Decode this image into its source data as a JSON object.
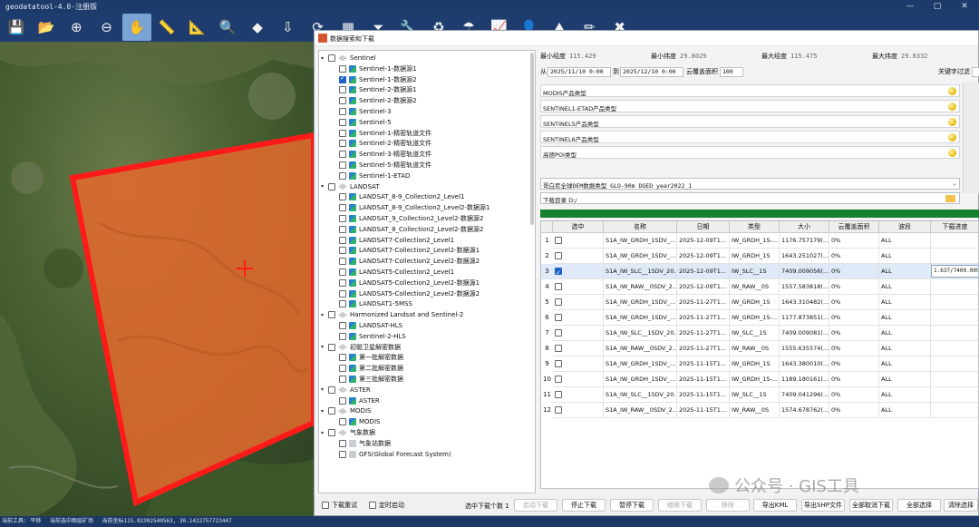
{
  "app": {
    "title": "geodatatool-4.0-注册版"
  },
  "toolbar": {
    "tools": [
      {
        "name": "save-icon",
        "glyph": "💾",
        "active": false
      },
      {
        "name": "open-folder-icon",
        "glyph": "📂",
        "active": false
      },
      {
        "name": "zoom-in-icon",
        "glyph": "⊕",
        "active": false
      },
      {
        "name": "zoom-out-icon",
        "glyph": "⊖",
        "active": false
      },
      {
        "name": "pan-hand-icon",
        "glyph": "✋",
        "active": true
      },
      {
        "name": "measure-ruler-icon",
        "glyph": "📏",
        "active": false
      },
      {
        "name": "measure-area-icon",
        "glyph": "📐",
        "active": false
      },
      {
        "name": "search-icon",
        "glyph": "🔍",
        "active": false
      },
      {
        "name": "layers-icon",
        "glyph": "◆",
        "active": false
      },
      {
        "name": "download-icon",
        "glyph": "⇩",
        "active": false
      },
      {
        "name": "refresh-icon",
        "glyph": "⟳",
        "active": false
      },
      {
        "name": "grid-icon",
        "glyph": "▦",
        "active": false
      },
      {
        "name": "filter-icon",
        "glyph": "⏷",
        "active": false
      },
      {
        "name": "settings-wrench-icon",
        "glyph": "🔧",
        "active": false
      },
      {
        "name": "sync-icon",
        "glyph": "♻",
        "active": false
      },
      {
        "name": "weather-icon",
        "glyph": "☂",
        "active": false
      },
      {
        "name": "chart-icon",
        "glyph": "📈",
        "active": false
      },
      {
        "name": "user-icon",
        "glyph": "👤",
        "active": false
      },
      {
        "name": "dem-icon",
        "glyph": "⛰",
        "active": false
      },
      {
        "name": "edit-pencil-icon",
        "glyph": "✏",
        "active": false
      },
      {
        "name": "close-red-icon",
        "glyph": "✖",
        "active": false
      }
    ]
  },
  "window_controls": {
    "minimize": "—",
    "restore": "▢",
    "close": "✕"
  },
  "status_bar": {
    "tool_text": "当前工具: 平移",
    "mode_text": "当前选中图层矿场",
    "coords_text": "当前坐标115.02302540563, 30.1422757723447"
  },
  "dialog": {
    "title": "数据搜索和下载",
    "tree": [
      {
        "level": 0,
        "caret": "▾",
        "label": "Sentinel",
        "checked": false,
        "icon": "group"
      },
      {
        "level": 1,
        "label": "Sentinel-1-数据源1",
        "checked": false,
        "icon": "item"
      },
      {
        "level": 1,
        "label": "Sentinel-1-数据源2",
        "checked": true,
        "icon": "item"
      },
      {
        "level": 1,
        "label": "Sentinel-2-数据源1",
        "checked": false,
        "icon": "item"
      },
      {
        "level": 1,
        "label": "Sentinel-2-数据源2",
        "checked": false,
        "icon": "item"
      },
      {
        "level": 1,
        "label": "Sentinel-3",
        "checked": false,
        "icon": "item"
      },
      {
        "level": 1,
        "label": "Sentinel-5",
        "checked": false,
        "icon": "item"
      },
      {
        "level": 1,
        "label": "Sentinel-1-精密轨道文件",
        "checked": false,
        "icon": "item"
      },
      {
        "level": 1,
        "label": "Sentinel-2-精密轨道文件",
        "checked": false,
        "icon": "item"
      },
      {
        "level": 1,
        "label": "Sentinel-3-精密轨道文件",
        "checked": false,
        "icon": "item"
      },
      {
        "level": 1,
        "label": "Sentinel-5-精密轨道文件",
        "checked": false,
        "icon": "item"
      },
      {
        "level": 1,
        "label": "Sentinel-1-ETAD",
        "checked": false,
        "icon": "item"
      },
      {
        "level": 0,
        "caret": "▾",
        "label": "LANDSAT",
        "checked": false,
        "icon": "group"
      },
      {
        "level": 1,
        "label": "LANDSAT_8-9_Collection2_Level1",
        "checked": false,
        "icon": "item"
      },
      {
        "level": 1,
        "label": "LANDSAT_8-9_Collection2_Level2-数据源1",
        "checked": false,
        "icon": "item"
      },
      {
        "level": 1,
        "label": "LANDSAT_9_Collection2_Level2-数据源2",
        "checked": false,
        "icon": "item"
      },
      {
        "level": 1,
        "label": "LANDSAT_8_Collection2_Level2-数据源2",
        "checked": false,
        "icon": "item"
      },
      {
        "level": 1,
        "label": "LANDSAT7-Collection2_Level1",
        "checked": false,
        "icon": "item"
      },
      {
        "level": 1,
        "label": "LANDSAT7-Collection2_Level2-数据源1",
        "checked": false,
        "icon": "item"
      },
      {
        "level": 1,
        "label": "LANDSAT7-Collection2_Level2-数据源2",
        "checked": false,
        "icon": "item"
      },
      {
        "level": 1,
        "label": "LANDSAT5-Collection2_Level1",
        "checked": false,
        "icon": "item"
      },
      {
        "level": 1,
        "label": "LANDSAT5-Collection2_Level2-数据源1",
        "checked": false,
        "icon": "item"
      },
      {
        "level": 1,
        "label": "LANDSAT5-Collection2_Level2-数据源2",
        "checked": false,
        "icon": "item"
      },
      {
        "level": 1,
        "label": "LANDSAT1-5MSS",
        "checked": false,
        "icon": "item"
      },
      {
        "level": 0,
        "caret": "▾",
        "label": "Harmonized Landsat and Sentinel-2",
        "checked": false,
        "icon": "group"
      },
      {
        "level": 1,
        "label": "LANDSAT-HLS",
        "checked": false,
        "icon": "item"
      },
      {
        "level": 1,
        "label": "Sentinel-2-HLS",
        "checked": false,
        "icon": "item"
      },
      {
        "level": 0,
        "caret": "▾",
        "label": "初聪卫星解密数据",
        "checked": false,
        "icon": "group"
      },
      {
        "level": 1,
        "label": "第一批解密数据",
        "checked": false,
        "icon": "item"
      },
      {
        "level": 1,
        "label": "第二批解密数据",
        "checked": false,
        "icon": "item"
      },
      {
        "level": 1,
        "label": "第三批解密数据",
        "checked": false,
        "icon": "item"
      },
      {
        "level": 0,
        "caret": "▾",
        "label": "ASTER",
        "checked": false,
        "icon": "group"
      },
      {
        "level": 1,
        "label": "ASTER",
        "checked": false,
        "icon": "item"
      },
      {
        "level": 0,
        "caret": "▾",
        "label": "MODIS",
        "checked": false,
        "icon": "group"
      },
      {
        "level": 1,
        "label": "MODIS",
        "checked": false,
        "icon": "item"
      },
      {
        "level": 0,
        "caret": "▾",
        "label": "气象数据",
        "checked": false,
        "icon": "group"
      },
      {
        "level": 1,
        "label": "气象站数据",
        "checked": false,
        "icon": "gray"
      },
      {
        "level": 1,
        "label": "GFS(Global Forecast System)",
        "checked": false,
        "icon": "gray"
      }
    ],
    "bounds": {
      "min_lon_label": "最小经度",
      "min_lon": "115.429",
      "min_lat_label": "最小纬度",
      "min_lat": "29.8029",
      "max_lon_label": "最大经度",
      "max_lon": "115.475",
      "max_lat_label": "最大纬度",
      "max_lat": "29.8332"
    },
    "filters": {
      "from_label": "从",
      "from_date": "2025/11/10 0:00",
      "to_label": "到",
      "to_date": "2025/12/10 0:00",
      "cloud_label": "云覆盖面积",
      "cloud_value": "100",
      "keyword_label": "关键字过滤"
    },
    "product_types": [
      "MODIS产品类型",
      "SENTINEL1-ETAD产品类型",
      "SENTINEL5产品类型",
      "SENTINEL6产品类型",
      "高德POI类型"
    ],
    "dem_select": "哥白尼全球DEM数据类型 GLO-90m DGED year2022_1",
    "download_dir": "下载目录 D:/",
    "table": {
      "columns": [
        "选中",
        "名称",
        "日期",
        "类型",
        "大小",
        "云覆盖面积",
        "波段",
        "下载进度"
      ],
      "rows": [
        {
          "num": "1",
          "checked": false,
          "name": "S1A_IW_GRDH_1SDV_...",
          "date": "2025-12-09T1...",
          "type": "IW_GRDH_1S-...",
          "size": "1176.757179(...",
          "cloud": "0%",
          "band": "ALL",
          "progress": ""
        },
        {
          "num": "2",
          "checked": false,
          "name": "S1A_IW_GRDH_1SDV_...",
          "date": "2025-12-09T1...",
          "type": "IW_GRDH_1S",
          "size": "1643.251027(...",
          "cloud": "0%",
          "band": "ALL",
          "progress": ""
        },
        {
          "num": "3",
          "checked": true,
          "name": "S1A_IW_SLC__1SDV_20...",
          "date": "2025-12-09T1...",
          "type": "IW_SLC__1S",
          "size": "7409.009056(...",
          "cloud": "0%",
          "band": "ALL",
          "progress": "1.637/7409.009"
        },
        {
          "num": "4",
          "checked": false,
          "name": "S1A_IW_RAW__0SDV_2...",
          "date": "2025-12-09T1...",
          "type": "IW_RAW__0S",
          "size": "1557.583818(...",
          "cloud": "0%",
          "band": "ALL",
          "progress": ""
        },
        {
          "num": "5",
          "checked": false,
          "name": "S1A_IW_GRDH_1SDV_...",
          "date": "2025-11-27T1...",
          "type": "IW_GRDH_1S",
          "size": "1643.310482(...",
          "cloud": "0%",
          "band": "ALL",
          "progress": ""
        },
        {
          "num": "6",
          "checked": false,
          "name": "S1A_IW_GRDH_1SDV_...",
          "date": "2025-11-27T1...",
          "type": "IW_GRDH_1S-...",
          "size": "1177.873851(...",
          "cloud": "0%",
          "band": "ALL",
          "progress": ""
        },
        {
          "num": "7",
          "checked": false,
          "name": "S1A_IW_SLC__1SDV_20...",
          "date": "2025-11-27T1...",
          "type": "IW_SLC__1S",
          "size": "7409.009081(...",
          "cloud": "0%",
          "band": "ALL",
          "progress": ""
        },
        {
          "num": "8",
          "checked": false,
          "name": "S1A_IW_RAW__0SDV_2...",
          "date": "2025-11-27T1...",
          "type": "IW_RAW__0S",
          "size": "1555.635574(...",
          "cloud": "0%",
          "band": "ALL",
          "progress": ""
        },
        {
          "num": "9",
          "checked": false,
          "name": "S1A_IW_GRDH_1SDV_...",
          "date": "2025-11-15T1...",
          "type": "IW_GRDH_1S",
          "size": "1643.380010(...",
          "cloud": "0%",
          "band": "ALL",
          "progress": ""
        },
        {
          "num": "10",
          "checked": false,
          "name": "S1A_IW_GRDH_1SDV_...",
          "date": "2025-11-15T1...",
          "type": "IW_GRDH_1S-...",
          "size": "1189.180161(...",
          "cloud": "0%",
          "band": "ALL",
          "progress": ""
        },
        {
          "num": "11",
          "checked": false,
          "name": "S1A_IW_SLC__1SDV_20...",
          "date": "2025-11-15T1...",
          "type": "IW_SLC__1S",
          "size": "7409.041296(...",
          "cloud": "0%",
          "band": "ALL",
          "progress": ""
        },
        {
          "num": "12",
          "checked": false,
          "name": "S1A_IW_RAW__0SDV_2...",
          "date": "2025-11-15T1...",
          "type": "IW_RAW__0S",
          "size": "1574.678762(...",
          "cloud": "0%",
          "band": "ALL",
          "progress": ""
        }
      ]
    },
    "bottom": {
      "retry_label": "下载重试",
      "timer_label": "定时启动",
      "selected_text": "选中下载个数 1",
      "buttons": [
        {
          "label": "启动下载",
          "disabled": true
        },
        {
          "label": "停止下载",
          "disabled": false
        },
        {
          "label": "暂停下载",
          "disabled": false
        },
        {
          "label": "继续下载",
          "disabled": true
        },
        {
          "label": "移除",
          "disabled": true
        },
        {
          "label": "导出KML",
          "disabled": false
        },
        {
          "label": "导出SHP文件",
          "disabled": false
        },
        {
          "label": "全部取消下载",
          "disabled": false
        },
        {
          "label": "全部选择",
          "disabled": false
        },
        {
          "label": "清除选择",
          "disabled": false
        }
      ]
    }
  },
  "watermark": {
    "text": "公众号 · GIS工具"
  },
  "colors": {
    "footprint_fill": "#e06a2c",
    "footprint_stroke": "#ff1a1a",
    "crosshair": "#ff1a1a",
    "progress_green": "#17802f",
    "checkbox_blue": "#1e62c8"
  }
}
